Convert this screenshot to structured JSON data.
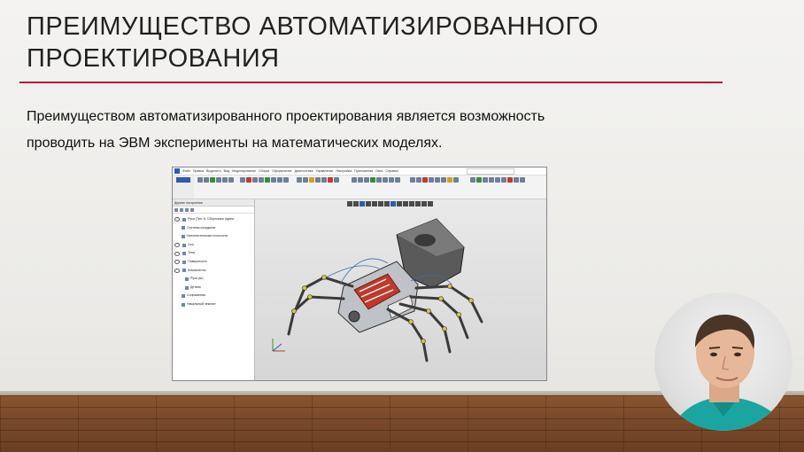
{
  "slide": {
    "title_line1": "ПРЕИМУЩЕСТВО АВТОМАТИЗИРОВАННОГО",
    "title_line2": "ПРОЕКТИРОВАНИЯ",
    "body_line1": "Преимуществом автоматизированного проектирования является возможность",
    "body_line2": "проводить на ЭВМ эксперименты на математических моделях.",
    "accent_color": "#b01a3a"
  },
  "cad": {
    "menu": [
      "Файл",
      "Правка",
      "Выделить",
      "Вид",
      "Моделирование",
      "Сборка",
      "Оформление",
      "Диагностика",
      "Управление",
      "Настройка",
      "Приложения",
      "Окно",
      "Справка"
    ],
    "tree_items": [
      "Рука (Тел. 6, Сборочные едини",
      "Система координат",
      "Исполнительные плоскости",
      "Оси",
      "Тела",
      "Поверхности",
      "Компоненты",
      "Рука (Ш)",
      "Деталь",
      "Сопряжения",
      "Начальный чекспит"
    ],
    "panel_title": "Дерево построения"
  },
  "icons": {
    "app_logo": "kompas-logo-icon",
    "eye": "eye-icon",
    "folder": "folder-icon",
    "axis": "axis-triad-icon"
  }
}
